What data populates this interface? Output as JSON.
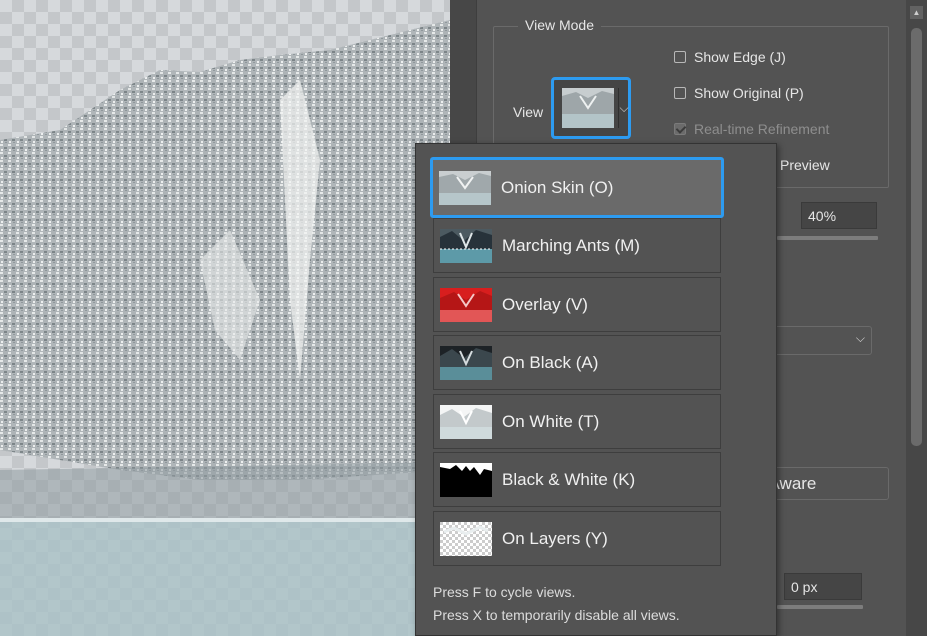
{
  "view_mode": {
    "title": "View Mode",
    "view_label": "View",
    "checkboxes": [
      {
        "label": "Show Edge (J)",
        "checked": false,
        "disabled": false
      },
      {
        "label": "Show Original (P)",
        "checked": false,
        "disabled": false
      },
      {
        "label": "Real-time Refinement",
        "checked": true,
        "disabled": true
      }
    ],
    "preview_label": "Preview"
  },
  "panel": {
    "opacity_value": "40%",
    "aware_button_label": "t Aware",
    "px_value": "0 px"
  },
  "dropdown": {
    "items": [
      {
        "label": "Onion Skin (O)",
        "thumb": "onion-skin",
        "selected": true
      },
      {
        "label": "Marching Ants (M)",
        "thumb": "marching-ants",
        "selected": false
      },
      {
        "label": "Overlay (V)",
        "thumb": "overlay",
        "selected": false
      },
      {
        "label": "On Black (A)",
        "thumb": "on-black",
        "selected": false
      },
      {
        "label": "On White (T)",
        "thumb": "on-white",
        "selected": false
      },
      {
        "label": "Black & White (K)",
        "thumb": "black-white",
        "selected": false
      },
      {
        "label": "On Layers (Y)",
        "thumb": "on-layers",
        "selected": false
      }
    ],
    "hints": [
      "Press F to cycle views.",
      "Press X to temporarily disable all views."
    ]
  },
  "colors": {
    "accent": "#2d9bf0",
    "panel_bg": "#535353",
    "overlay_red": "#d81e1e"
  }
}
